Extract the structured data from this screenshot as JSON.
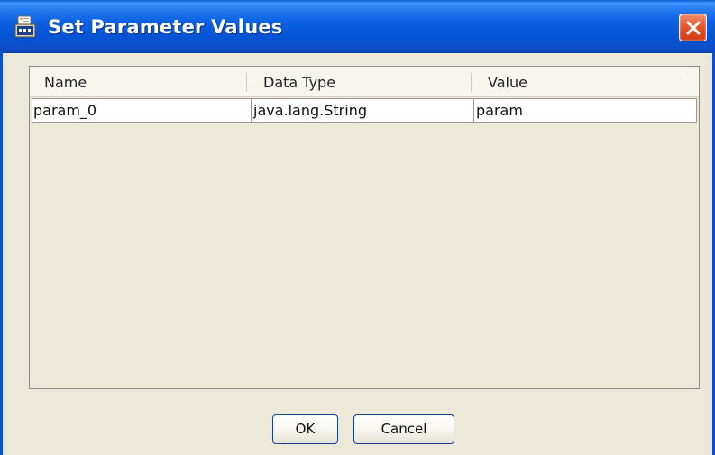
{
  "window": {
    "title": "Set Parameter Values"
  },
  "icons": {
    "app": "report-parameter-icon",
    "close": "close-icon"
  },
  "table": {
    "columns": [
      "Name",
      "Data Type",
      "Value"
    ],
    "rows": [
      [
        "param_0",
        "java.lang.String",
        "param"
      ]
    ]
  },
  "buttons": {
    "ok_label": "OK",
    "cancel_label": "Cancel"
  },
  "colors": {
    "title_bar": "#0553d6",
    "close_button": "#e5562d",
    "dialog_background": "#ece9d8"
  }
}
